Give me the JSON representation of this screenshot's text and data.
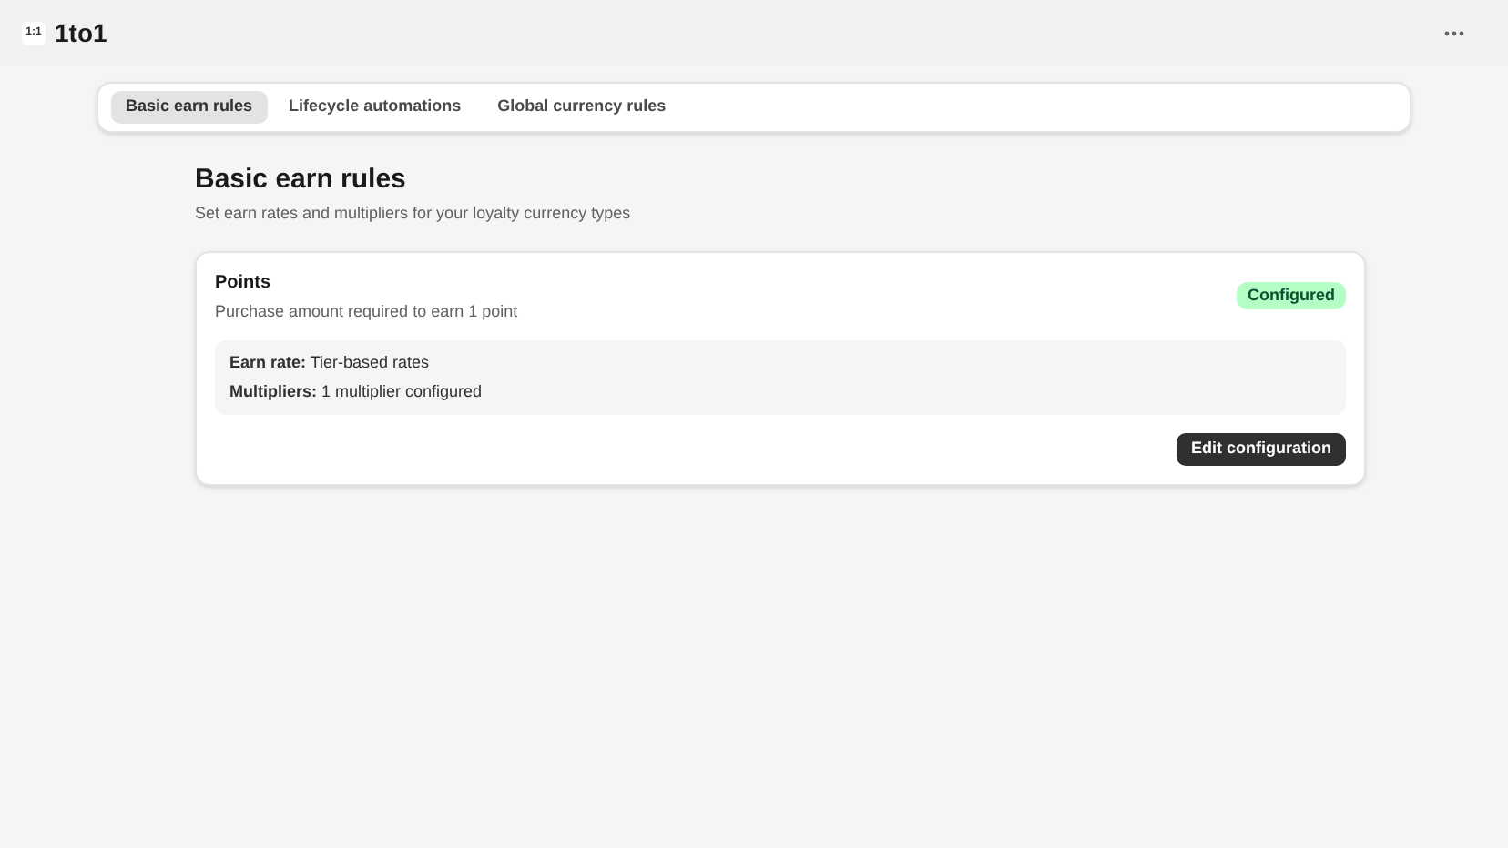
{
  "app": {
    "logo": "1:1",
    "name": "1to1"
  },
  "tabs": [
    {
      "label": "Basic earn rules",
      "selected": true
    },
    {
      "label": "Lifecycle automations",
      "selected": false
    },
    {
      "label": "Global currency rules",
      "selected": false
    }
  ],
  "page": {
    "title": "Basic earn rules",
    "subtitle": "Set earn rates and multipliers for your loyalty currency types"
  },
  "cards": [
    {
      "title": "Points",
      "description": "Purchase amount required to earn 1 point",
      "badge": "Configured",
      "details": [
        "**Earn rate:** Tier-based rates",
        "**Multipliers:** 1 multiplier configured"
      ],
      "action": "Edit configuration"
    }
  ]
}
